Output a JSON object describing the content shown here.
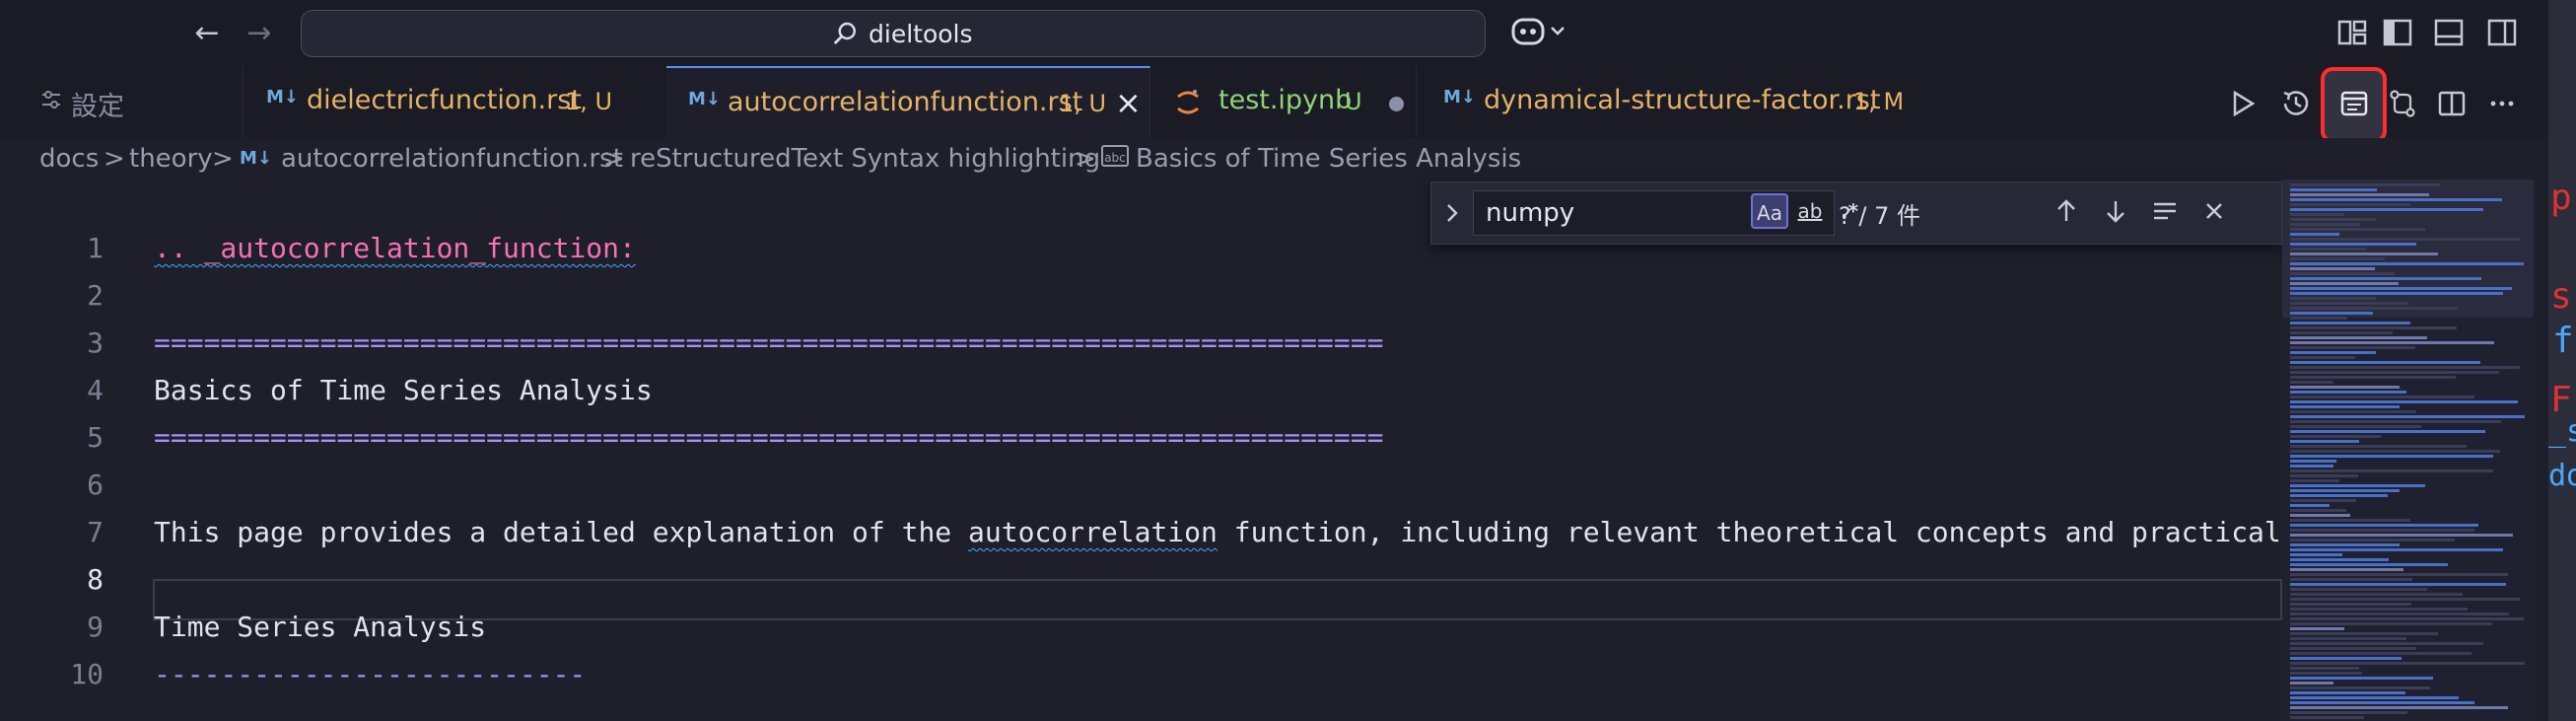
{
  "titlebar": {
    "search_text": "dieltools"
  },
  "tabs": [
    {
      "label": "設定",
      "kind": "settings"
    },
    {
      "label": "dielectricfunction.rst",
      "badge": "1, U",
      "label_color": "#e5b268",
      "kind": "rst"
    },
    {
      "label": "autocorrelationfunction.rst",
      "badge": "1, U",
      "label_color": "#e5b268",
      "kind": "rst",
      "active": true
    },
    {
      "label": "test.ipynb",
      "badge": "U",
      "label_color": "#8fd37a",
      "kind": "jupyter"
    },
    {
      "label": "dynamical-structure-factor.rst",
      "badge": "1, M",
      "label_color": "#e5b268",
      "kind": "rst"
    }
  ],
  "tab_icon_text": "M↓",
  "breadcrumb": {
    "items": [
      "docs",
      "theory",
      "autocorrelationfunction.rst",
      "reStructuredText Syntax highlighting",
      "Basics of Time Series Analysis"
    ],
    "sep": ">",
    "abc_icon": "abc"
  },
  "find": {
    "value": "numpy",
    "case_label": "Aa",
    "word_label": "ab",
    "regex_label": ".*",
    "count": "? / 7 件"
  },
  "editor": {
    "lines": [
      {
        "n": "1",
        "text": ".. _autocorrelation_function:",
        "style": "pink"
      },
      {
        "n": "2",
        "text": "",
        "style": ""
      },
      {
        "n": "3",
        "text": "==========================================================================",
        "style": "lav"
      },
      {
        "n": "4",
        "text": "Basics of Time Series Analysis",
        "style": ""
      },
      {
        "n": "5",
        "text": "==========================================================================",
        "style": "lav"
      },
      {
        "n": "6",
        "text": "",
        "style": ""
      },
      {
        "n": "7",
        "text": "This page provides a detailed explanation of the autocorrelation function, including relevant theoretical concepts and practical implem",
        "style": ""
      },
      {
        "n": "8",
        "text": "",
        "style": ""
      },
      {
        "n": "9",
        "text": "Time Series Analysis",
        "style": ""
      },
      {
        "n": "10",
        "text": "--------------------------",
        "style": "lav"
      }
    ]
  },
  "right_strip": {
    "fragments": [
      "p",
      "s",
      "f",
      "F",
      "_s",
      "do"
    ]
  },
  "colors": {
    "accent": "#5b8cff",
    "highlight_box": "#ff2d2d",
    "modified_yellow": "#e5b268",
    "untracked_green": "#8fd37a"
  }
}
